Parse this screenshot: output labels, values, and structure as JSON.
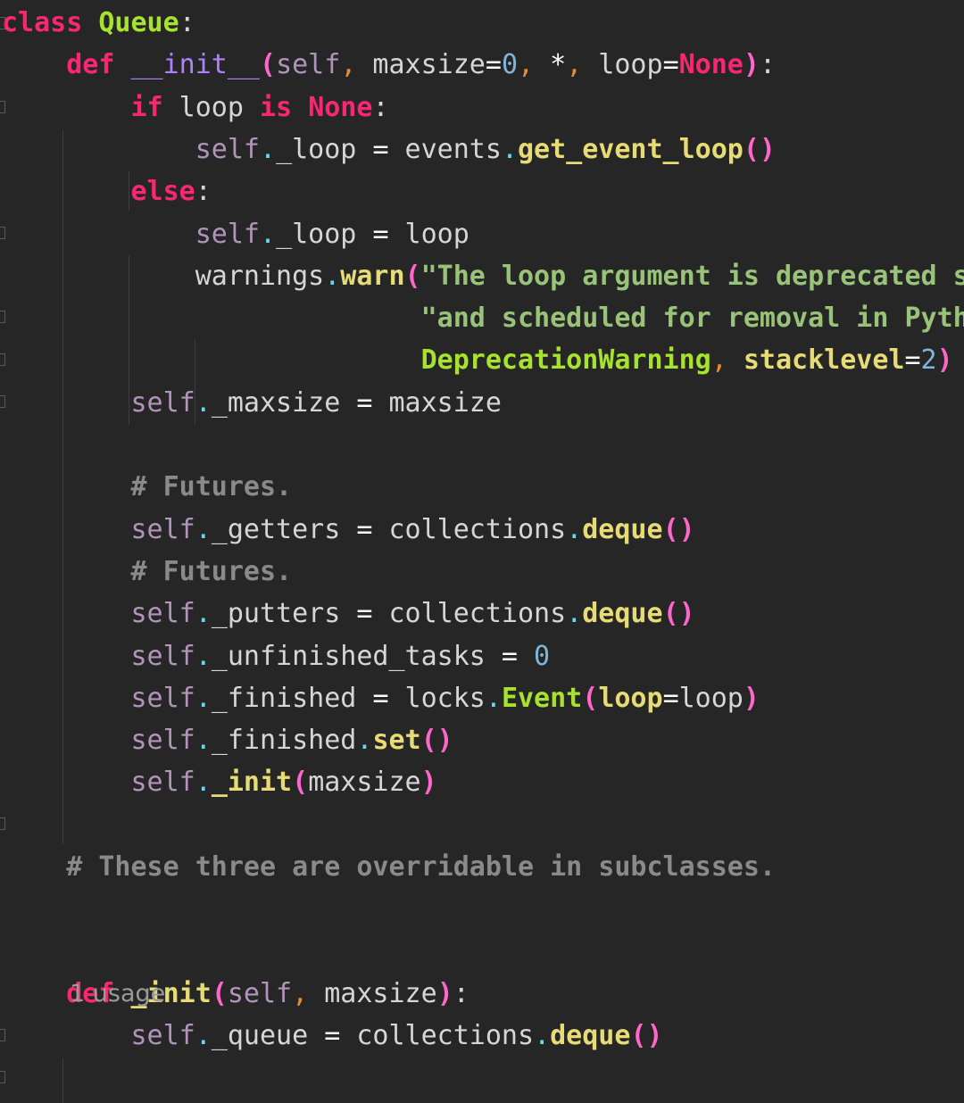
{
  "editor": {
    "hint_usage": "1 usage",
    "lines": [
      {
        "tokens": [
          [
            "kw",
            "class"
          ],
          [
            "punc",
            " "
          ],
          [
            "cls",
            "Queue"
          ],
          [
            "punc",
            ":"
          ]
        ]
      },
      {
        "tokens": [
          [
            "punc",
            "    "
          ],
          [
            "kw",
            "def"
          ],
          [
            "punc",
            " "
          ],
          [
            "magic",
            "__init__"
          ],
          [
            "paren",
            "("
          ],
          [
            "slf",
            "self"
          ],
          [
            "comma",
            ","
          ],
          [
            "punc",
            " maxsize"
          ],
          [
            "op",
            "="
          ],
          [
            "num",
            "0"
          ],
          [
            "comma",
            ","
          ],
          [
            "punc",
            " "
          ],
          [
            "op",
            "*"
          ],
          [
            "comma",
            ","
          ],
          [
            "punc",
            " loop"
          ],
          [
            "op",
            "="
          ],
          [
            "kw",
            "None"
          ],
          [
            "paren",
            ")"
          ],
          [
            "punc",
            ":"
          ]
        ]
      },
      {
        "tokens": [
          [
            "punc",
            "        "
          ],
          [
            "kw",
            "if"
          ],
          [
            "punc",
            " loop "
          ],
          [
            "kw",
            "is"
          ],
          [
            "punc",
            " "
          ],
          [
            "kw",
            "None"
          ],
          [
            "punc",
            ":"
          ]
        ]
      },
      {
        "tokens": [
          [
            "punc",
            "            "
          ],
          [
            "slf",
            "self"
          ],
          [
            "dot",
            "."
          ],
          [
            "punc",
            "_loop "
          ],
          [
            "op",
            "="
          ],
          [
            "punc",
            " events"
          ],
          [
            "dot",
            "."
          ],
          [
            "fn",
            "get_event_loop"
          ],
          [
            "paren",
            "()"
          ]
        ]
      },
      {
        "tokens": [
          [
            "punc",
            "        "
          ],
          [
            "kw",
            "else"
          ],
          [
            "punc",
            ":"
          ]
        ]
      },
      {
        "tokens": [
          [
            "punc",
            "            "
          ],
          [
            "slf",
            "self"
          ],
          [
            "dot",
            "."
          ],
          [
            "punc",
            "_loop "
          ],
          [
            "op",
            "="
          ],
          [
            "punc",
            " loop"
          ]
        ]
      },
      {
        "tokens": [
          [
            "punc",
            "            warnings"
          ],
          [
            "dot",
            "."
          ],
          [
            "fn",
            "warn"
          ],
          [
            "paren",
            "("
          ],
          [
            "str",
            "\"The loop argument is deprecated s"
          ]
        ]
      },
      {
        "tokens": [
          [
            "punc",
            "                          "
          ],
          [
            "str",
            "\"and scheduled for removal in Pyth"
          ]
        ]
      },
      {
        "tokens": [
          [
            "punc",
            "                          "
          ],
          [
            "builtin",
            "DeprecationWarning"
          ],
          [
            "comma",
            ","
          ],
          [
            "punc",
            " "
          ],
          [
            "kwarg",
            "stacklevel"
          ],
          [
            "op",
            "="
          ],
          [
            "num",
            "2"
          ],
          [
            "paren",
            ")"
          ]
        ]
      },
      {
        "tokens": [
          [
            "punc",
            "        "
          ],
          [
            "slf",
            "self"
          ],
          [
            "dot",
            "."
          ],
          [
            "punc",
            "_maxsize "
          ],
          [
            "op",
            "="
          ],
          [
            "punc",
            " maxsize"
          ]
        ]
      },
      {
        "tokens": []
      },
      {
        "tokens": [
          [
            "punc",
            "        "
          ],
          [
            "comment",
            "# Futures."
          ]
        ]
      },
      {
        "tokens": [
          [
            "punc",
            "        "
          ],
          [
            "slf",
            "self"
          ],
          [
            "dot",
            "."
          ],
          [
            "punc",
            "_getters "
          ],
          [
            "op",
            "="
          ],
          [
            "punc",
            " collections"
          ],
          [
            "dot",
            "."
          ],
          [
            "fn",
            "deque"
          ],
          [
            "paren",
            "()"
          ]
        ]
      },
      {
        "tokens": [
          [
            "punc",
            "        "
          ],
          [
            "comment",
            "# Futures."
          ]
        ]
      },
      {
        "tokens": [
          [
            "punc",
            "        "
          ],
          [
            "slf",
            "self"
          ],
          [
            "dot",
            "."
          ],
          [
            "punc",
            "_putters "
          ],
          [
            "op",
            "="
          ],
          [
            "punc",
            " collections"
          ],
          [
            "dot",
            "."
          ],
          [
            "fn",
            "deque"
          ],
          [
            "paren",
            "()"
          ]
        ]
      },
      {
        "tokens": [
          [
            "punc",
            "        "
          ],
          [
            "slf",
            "self"
          ],
          [
            "dot",
            "."
          ],
          [
            "punc",
            "_unfinished_tasks "
          ],
          [
            "op",
            "="
          ],
          [
            "punc",
            " "
          ],
          [
            "num",
            "0"
          ]
        ]
      },
      {
        "tokens": [
          [
            "punc",
            "        "
          ],
          [
            "slf",
            "self"
          ],
          [
            "dot",
            "."
          ],
          [
            "punc",
            "_finished "
          ],
          [
            "op",
            "="
          ],
          [
            "punc",
            " locks"
          ],
          [
            "dot",
            "."
          ],
          [
            "cls",
            "Event"
          ],
          [
            "paren",
            "("
          ],
          [
            "kwarg",
            "loop"
          ],
          [
            "op",
            "="
          ],
          [
            "punc",
            "loop"
          ],
          [
            "paren",
            ")"
          ]
        ]
      },
      {
        "tokens": [
          [
            "punc",
            "        "
          ],
          [
            "slf",
            "self"
          ],
          [
            "dot",
            "."
          ],
          [
            "punc",
            "_finished"
          ],
          [
            "dot",
            "."
          ],
          [
            "fn",
            "set"
          ],
          [
            "paren",
            "()"
          ]
        ]
      },
      {
        "tokens": [
          [
            "punc",
            "        "
          ],
          [
            "slf",
            "self"
          ],
          [
            "dot",
            "."
          ],
          [
            "fn",
            "_init"
          ],
          [
            "paren",
            "("
          ],
          [
            "punc",
            "maxsize"
          ],
          [
            "paren",
            ")"
          ]
        ]
      },
      {
        "tokens": []
      },
      {
        "tokens": [
          [
            "punc",
            "    "
          ],
          [
            "comment",
            "# These three are overridable in subclasses."
          ]
        ]
      },
      {
        "tokens": []
      },
      {
        "tokens": []
      },
      {
        "tokens": [
          [
            "punc",
            "    "
          ],
          [
            "kw",
            "def"
          ],
          [
            "punc",
            " "
          ],
          [
            "fn",
            "_init"
          ],
          [
            "paren",
            "("
          ],
          [
            "slf",
            "self"
          ],
          [
            "comma",
            ","
          ],
          [
            "punc",
            " maxsize"
          ],
          [
            "paren",
            ")"
          ],
          [
            "punc",
            ":"
          ]
        ]
      },
      {
        "tokens": [
          [
            "punc",
            "        "
          ],
          [
            "slf",
            "self"
          ],
          [
            "dot",
            "."
          ],
          [
            "punc",
            "_queue "
          ],
          [
            "op",
            "="
          ],
          [
            "punc",
            " collections"
          ],
          [
            "dot",
            "."
          ],
          [
            "fn",
            "deque"
          ],
          [
            "paren",
            "()"
          ]
        ]
      }
    ]
  }
}
